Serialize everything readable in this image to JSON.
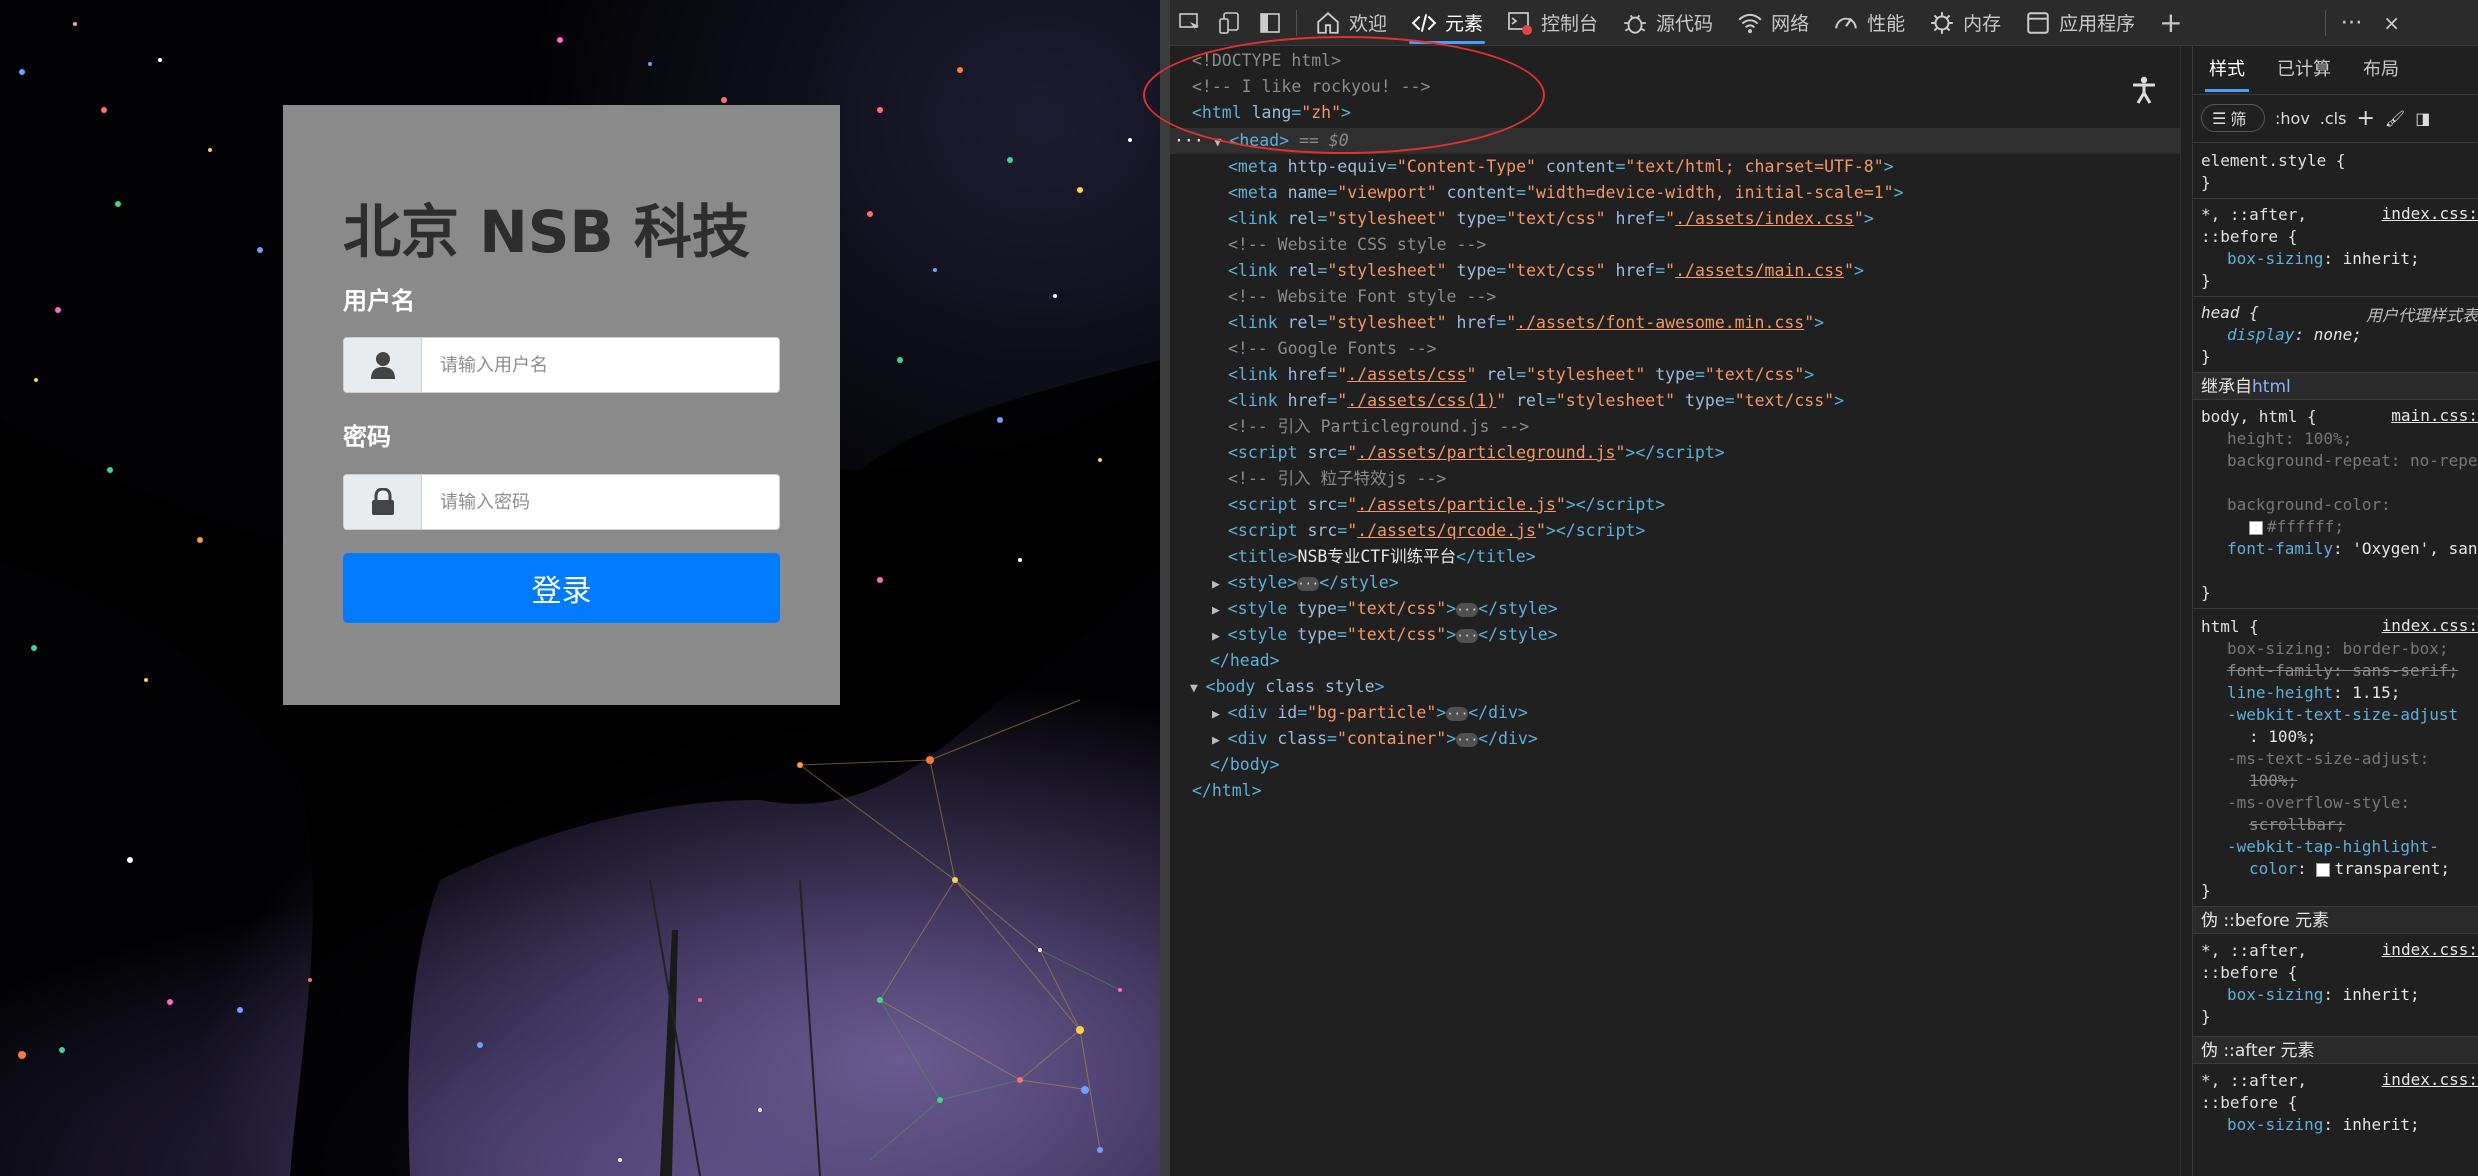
{
  "page": {
    "brand_title": "北京 NSB 科技",
    "username_label": "用户名",
    "username_placeholder": "请输入用户名",
    "password_label": "密码",
    "password_placeholder": "请输入密码",
    "login_button": "登录"
  },
  "devtools": {
    "tabs": [
      {
        "label": "欢迎",
        "icon": "home-icon"
      },
      {
        "label": "元素",
        "icon": "code-icon",
        "active": true
      },
      {
        "label": "控制台",
        "icon": "console-icon"
      },
      {
        "label": "源代码",
        "icon": "bug-icon"
      },
      {
        "label": "网络",
        "icon": "wifi-icon"
      },
      {
        "label": "性能",
        "icon": "gauge-icon"
      },
      {
        "label": "内存",
        "icon": "memory-icon"
      },
      {
        "label": "应用程序",
        "icon": "app-icon"
      }
    ],
    "accent_color": "#4a9df8",
    "dom": {
      "doctype": "<!DOCTYPE html>",
      "comment_rockyou": "<!-- I like rockyou! -->",
      "html_open_tag": "<html",
      "html_lang_attr": "lang",
      "html_lang_val": "\"zh\"",
      "head_tag": "<head>",
      "head_sel": "== $0",
      "meta1_attr1": "http-equiv",
      "meta1_val1": "\"Content-Type\"",
      "meta1_attr2": "content",
      "meta1_val2": "\"text/html; charset=UTF-8\"",
      "meta2_attr1": "name",
      "meta2_val1": "\"viewport\"",
      "meta2_attr2": "content",
      "meta2_val2": "\"width=device-width, initial-scale=1\"",
      "rel": "rel",
      "type": "type",
      "href": "href",
      "src": "src",
      "stylesheet": "\"stylesheet\"",
      "textcss": "\"text/css\"",
      "href_index": "./assets/index.css",
      "comment_site_css": "<!-- Website CSS style -->",
      "href_main": "./assets/main.css",
      "comment_site_font": "<!-- Website Font style -->",
      "href_fa": "./assets/font-awesome.min.css",
      "comment_gfonts": "<!-- Google Fonts -->",
      "href_css": "./assets/css",
      "href_css1": "./assets/css(1)",
      "comment_particleground": "<!-- 引入 Particleground.js -->",
      "src_particleground": "./assets/particleground.js",
      "comment_particle": "<!-- 引入 粒子特效js -->",
      "src_particle": "./assets/particle.js",
      "src_qrcode": "./assets/qrcode.js",
      "title_text": "NSB专业CTF训练平台",
      "style_tag": "<style>",
      "style_close": "</style>",
      "head_close": "</head>",
      "body_open": "<body",
      "body_class": "class",
      "body_style": "style",
      "div_bg_id": "\"bg-particle\"",
      "div_container": "\"container\"",
      "id": "id",
      "div_close": "</div>",
      "body_close": "</body>",
      "html_close": "</html>"
    },
    "styles": {
      "tabs": [
        "样式",
        "已计算",
        "布局"
      ],
      "filter_placeholder": "筛",
      "hov": ":hov",
      "cls": ".cls",
      "element_style": "element.style {",
      "universal_sel1": "*, ::after,",
      "universal_sel2": "::before {",
      "index_src": "index.css:",
      "box_sizing": "box-sizing",
      "inherit": "inherit;",
      "head_sel": "head {",
      "ua_sheet": "用户代理样式表",
      "display": "display",
      "none": "none;",
      "inherited_from": "继承自",
      "inherited_el": "html",
      "body_html_sel": "body, html {",
      "main_src": "main.css:",
      "height": "height",
      "height_val": "100%;",
      "bg_repeat": "background-repeat",
      "bg_repeat_val": "no-repeat;",
      "bg_color": "background-color",
      "bg_color_val": "#ffffff;",
      "font_family": "font-family",
      "font_family_val": "'Oxygen', sans-serif;",
      "html_sel": "html {",
      "box_sizing_bb": "border-box;",
      "ff_struck": "font-family: sans-serif;",
      "line_height": "line-height",
      "line_height_val": "1.15;",
      "webkit_tsa": "-webkit-text-size-adjust",
      "webkit_tsa_val": ": 100%;",
      "ms_tsa": "-ms-text-size-adjust:",
      "ms_tsa_val": "100%;",
      "ms_os": "-ms-overflow-style:",
      "ms_os_val": "scrollbar;",
      "tap_hl": "-webkit-tap-highlight-",
      "tap_hl2": "color",
      "transparent": "transparent;",
      "pseudo_before": "伪 ::before 元素",
      "pseudo_after": "伪 ::after 元素",
      "close_brace": "}"
    }
  }
}
